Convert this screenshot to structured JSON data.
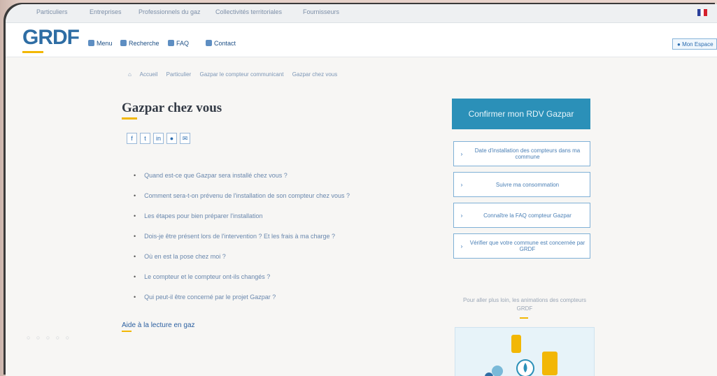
{
  "topnav": {
    "items": [
      "Particuliers",
      "Entreprises",
      "Professionnels du gaz",
      "Collectivités territoriales",
      "Fournisseurs"
    ]
  },
  "brand": {
    "logo": "GRDF"
  },
  "header": {
    "nav": [
      "Menu",
      "Recherche",
      "FAQ",
      "Contact"
    ],
    "login": "Mon Espace"
  },
  "breadcrumb": [
    "Accueil",
    "Particulier",
    "Gazpar le compteur communicant",
    "Gazpar chez vous"
  ],
  "page": {
    "title": "Gazpar chez vous"
  },
  "share": [
    "f",
    "t",
    "in",
    "●",
    "✉"
  ],
  "faq": [
    "Quand est-ce que Gazpar sera installé chez vous ?",
    "Comment sera-t-on prévenu de l'installation de son compteur chez vous ?",
    "Les étapes pour bien préparer l'installation",
    "Dois-je être présent lors de l'intervention ? Et les frais à ma charge ?",
    "Où en est la pose chez moi ?",
    "Le compteur et le compteur ont-ils changés ?",
    "Qui peut-il être concerné par le projet Gazpar ?"
  ],
  "subhead": "Aide à la lecture en gaz",
  "sidebar": {
    "cta": "Confirmer mon RDV Gazpar",
    "links": [
      "Date d'installation des compteurs dans ma commune",
      "Suivre ma consommation",
      "Connaître la FAQ compteur Gazpar",
      "Vérifier que votre commune est concernée par GRDF"
    ],
    "promo": "Pour aller plus loin, les animations des compteurs GRDF"
  }
}
